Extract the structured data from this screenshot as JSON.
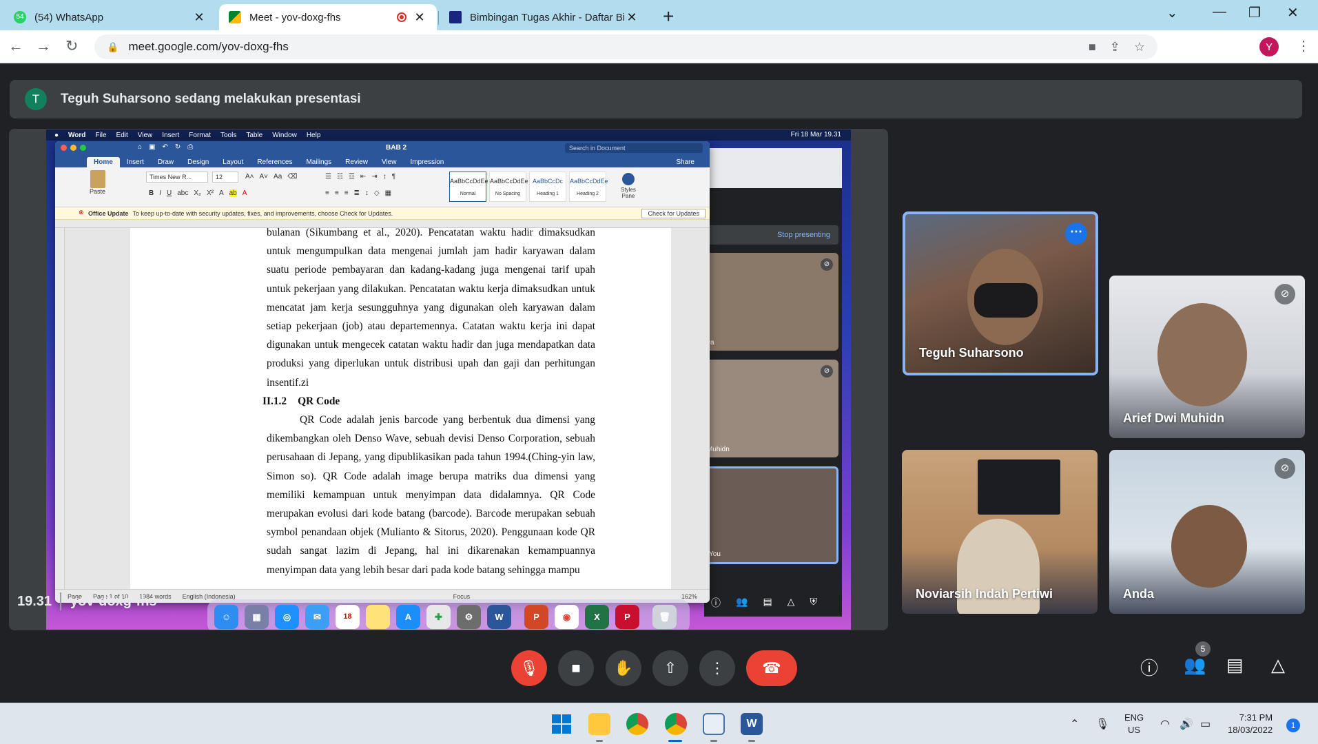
{
  "browser": {
    "tabs": [
      {
        "title": "(54) WhatsApp",
        "badge": "54"
      },
      {
        "title": "Meet - yov-doxg-fhs",
        "recording": true
      },
      {
        "title": "Bimbingan Tugas Akhir - Daftar Bim"
      }
    ],
    "url": "meet.google.com/yov-doxg-fhs",
    "profile_initial": "Y"
  },
  "presenter": {
    "initial": "T",
    "banner": "Teguh Suharsono sedang melakukan presentasi"
  },
  "mac": {
    "menubar": [
      "Word",
      "File",
      "Edit",
      "View",
      "Insert",
      "Format",
      "Tools",
      "Table",
      "Window",
      "Help"
    ],
    "datetime": "Fri 18 Mar  19.31"
  },
  "word": {
    "doc_title": "BAB 2",
    "search_placeholder": "Search in Document",
    "tabs": [
      "Home",
      "Insert",
      "Draw",
      "Design",
      "Layout",
      "References",
      "Mailings",
      "Review",
      "View",
      "Impression"
    ],
    "share_label": "Share",
    "font_name": "Times New R...",
    "font_size": "12",
    "paste_label": "Paste",
    "styles": [
      {
        "sample": "AaBbCcDdEe",
        "name": "Normal"
      },
      {
        "sample": "AaBbCcDdEe",
        "name": "No Spacing"
      },
      {
        "sample": "AaBbCcDc",
        "name": "Heading 1"
      },
      {
        "sample": "AaBbCcDdEe",
        "name": "Heading 2"
      }
    ],
    "styles_pane": "Styles Pane",
    "update_title": "Office Update",
    "update_text": "To keep up-to-date with security updates, fixes, and improvements, choose Check for Updates.",
    "update_button": "Check for Updates",
    "paragraph1": "bulanan (Sikumbang et al., 2020). Pencatatan waktu hadir dimaksudkan untuk mengumpulkan data mengenai jumlah jam hadir karyawan dalam suatu periode pembayaran dan kadang-kadang juga mengenai tarif upah untuk pekerjaan yang dilakukan. Pencatatan waktu kerja dimaksudkan untuk mencatat jam kerja sesungguhnya yang digunakan oleh karyawan dalam setiap pekerjaan (job) atau departemennya. Catatan waktu kerja ini dapat digunakan untuk mengecek catatan waktu hadir dan juga mendapatkan data produksi yang diperlukan untuk distribusi upah dan gaji dan perhitungan insentif.zi",
    "heading_number": "II.1.2",
    "heading_text": "QR Code",
    "paragraph2": "QR Code adalah jenis barcode yang berbentuk dua dimensi yang dikembangkan oleh Denso Wave, sebuah devisi Denso Corporation, sebuah perusahaan di Jepang, yang dipublikasikan pada tahun 1994.(Ching-yin law, Simon so). QR Code adalah image berupa matriks dua dimensi yang memiliki kemampuan untuk menyimpan data didalamnya. QR Code merupakan evolusi dari kode batang (barcode). Barcode merupakan sebuah symbol penandaan objek (Mulianto & Sitorus, 2020). Penggunaan kode QR sudah sangat lazim di Jepang, hal ini dikarenakan kemampuannya menyimpan data yang lebih besar dari pada kode batang sehingga mampu",
    "status": {
      "page_label": "Page",
      "page": "Page 1 of 10",
      "words": "1984 words",
      "language": "English (Indonesia)",
      "focus": "Focus",
      "zoom": "162%"
    }
  },
  "mini_meet": {
    "stop_presenting": "Stop presenting",
    "tiles": [
      "ya",
      "Muhidn",
      "You"
    ]
  },
  "participants": [
    {
      "name": "Teguh Suharsono",
      "speaking": true,
      "muted": false
    },
    {
      "name": "Arief Dwi Muhidn",
      "speaking": false,
      "muted": true
    },
    {
      "name": "Noviarsih Indah Pertiwi",
      "speaking": false,
      "muted": false
    },
    {
      "name": "Anda",
      "speaking": false,
      "muted": true
    }
  ],
  "meeting": {
    "time": "19.31",
    "code": "yov-doxg-fhs",
    "participant_count": "5"
  },
  "taskbar": {
    "lang_line1": "ENG",
    "lang_line2": "US",
    "time": "7:31 PM",
    "date": "18/03/2022",
    "notifications": "1"
  },
  "colors": {
    "meet_bg": "#202124",
    "leave_red": "#ea4335",
    "speaking_border": "#8ab4f8",
    "word_blue": "#2b579a"
  }
}
